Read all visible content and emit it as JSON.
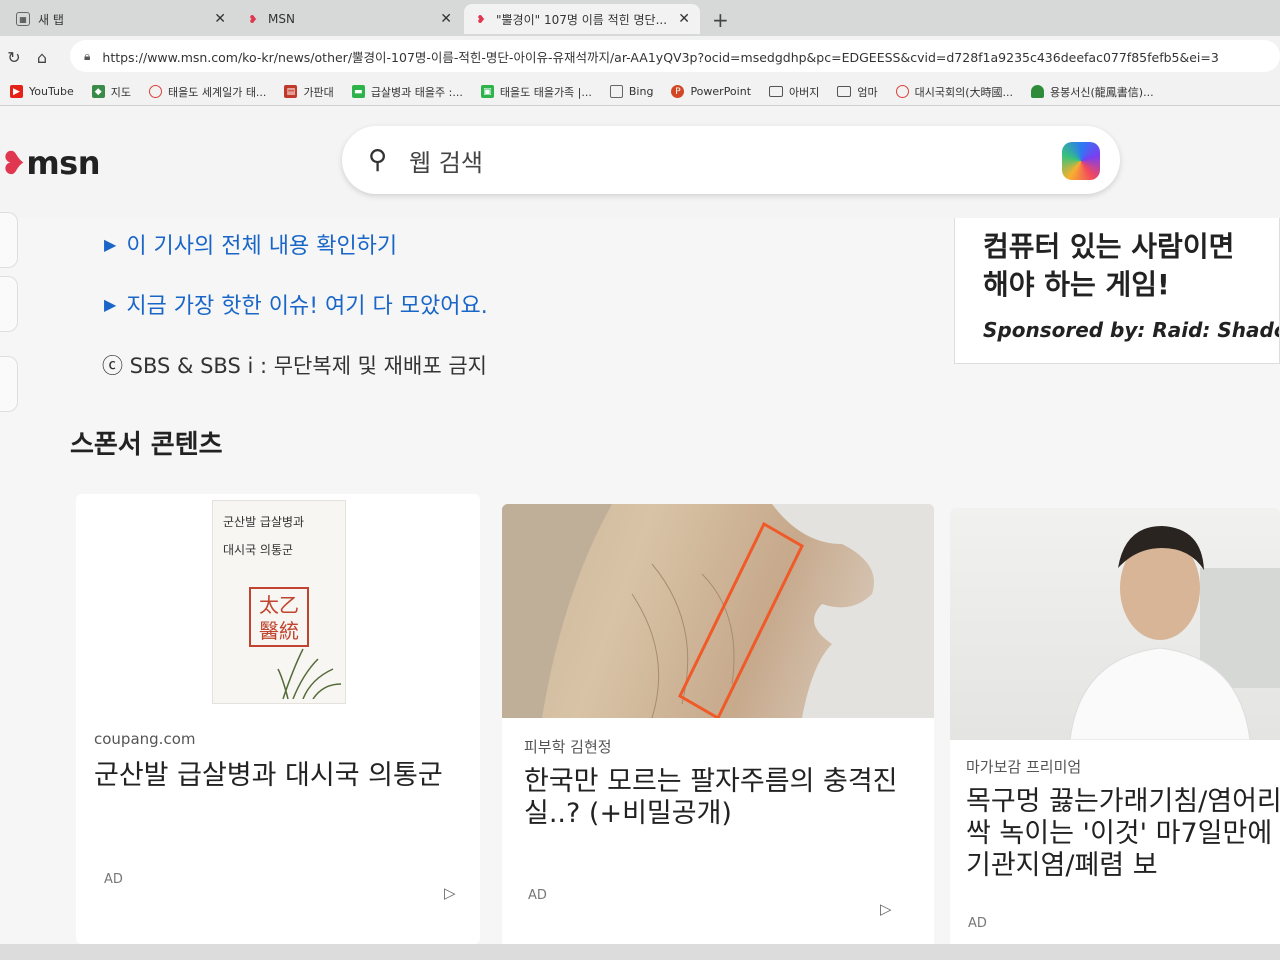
{
  "browser": {
    "tabs": [
      {
        "title": "새 탭",
        "active": false
      },
      {
        "title": "MSN",
        "active": false
      },
      {
        "title": "\"뿔경이\" 107명 이름 적힌 명단...",
        "active": true
      }
    ],
    "new_tab_label": "+",
    "url": "https://www.msn.com/ko-kr/news/other/뿔경이-107명-이름-적힌-명단-아이유-유재석까지/ar-AA1yQV3p?ocid=msedgdhp&pc=EDGEESS&cvid=d728f1a9235c436deefac077f85fefb5&ei=3",
    "bookmarks": [
      {
        "label": "YouTube",
        "icon": "youtube-icon",
        "color": "#e62117"
      },
      {
        "label": "지도",
        "icon": "maps-icon",
        "color": "#3a8a4a"
      },
      {
        "label": "태을도 세계일가 태...",
        "icon": "circle-icon",
        "color": "#d9433a"
      },
      {
        "label": "가판대",
        "icon": "news-icon",
        "color": "#c0392b"
      },
      {
        "label": "급살병과 태을주 :...",
        "icon": "chat-icon",
        "color": "#2eb34a"
      },
      {
        "label": "태을도 태을가족 |...",
        "icon": "doc-icon",
        "color": "#2eb34a"
      },
      {
        "label": "Bing",
        "icon": "page-icon",
        "color": "#666666"
      },
      {
        "label": "PowerPoint",
        "icon": "powerpoint-icon",
        "color": "#d24726"
      },
      {
        "label": "아버지",
        "icon": "folder-icon",
        "color": "#555555"
      },
      {
        "label": "엄마",
        "icon": "folder-icon",
        "color": "#555555"
      },
      {
        "label": "대시국회의(大時國...",
        "icon": "circle-icon",
        "color": "#d9433a"
      },
      {
        "label": "용봉서신(龍鳳書信)...",
        "icon": "tree-icon",
        "color": "#2e8b3a"
      }
    ]
  },
  "msn": {
    "logo": "msn",
    "search_placeholder": "웹 검색"
  },
  "article": {
    "links": [
      "이 기사의 전체 내용 확인하기",
      "지금 가장 핫한 이슈! 여기 다 모았어요."
    ],
    "copyright": "ⓒ SBS & SBS i : 무단복제 및 재배포 금지"
  },
  "sponsor_box": {
    "headline_line1": "컴퓨터 있는 사람이면",
    "headline_line2": "해야 하는 게임!",
    "sponsored_by": "Sponsored by: Raid: Shadow"
  },
  "sponsored_section": {
    "title": "스폰서 콘텐츠",
    "cards": [
      {
        "source": "coupang.com",
        "title": "군산발 급살병과 대시국 의통군",
        "ad": "AD",
        "book_text_1": "군산발  급살병과",
        "book_text_2": "대시국  의통군",
        "book_seal": "太乙醫統"
      },
      {
        "source": "피부학 김현정",
        "title": "한국만 모르는 팔자주름의 충격진실..? (+비밀공개)",
        "ad": "AD"
      },
      {
        "source": "마가보감 프리미엄",
        "title": "목구멍 끓는가래기침/염어리 싹 녹이는 '이것' 마7일만에 기관지염/폐렴 보",
        "ad": "AD"
      }
    ]
  },
  "colors": {
    "link_blue": "#1a66c8",
    "msn_butterfly": "#e0364f"
  }
}
